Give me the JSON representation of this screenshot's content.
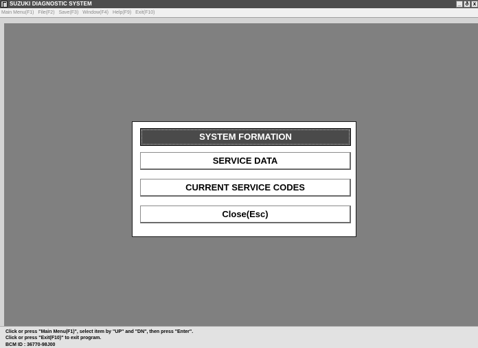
{
  "window": {
    "title": "SUZUKI DIAGNOSTIC SYSTEM",
    "controls": [
      "_",
      "ð",
      "x"
    ]
  },
  "menubar": {
    "items": [
      {
        "label": "Main Menu(F1)"
      },
      {
        "label": "File(F2)"
      },
      {
        "label": "Save(F3)"
      },
      {
        "label": "Window(F4)"
      },
      {
        "label": "Help(F9)"
      },
      {
        "label": "Exit(F10)"
      }
    ]
  },
  "dialog": {
    "options": [
      {
        "label": "SYSTEM FORMATION",
        "selected": true
      },
      {
        "label": "SERVICE DATA",
        "selected": false
      },
      {
        "label": "CURRENT SERVICE CODES",
        "selected": false
      },
      {
        "label": "Close(Esc)",
        "selected": false
      }
    ]
  },
  "status": {
    "line1": "Click or press \"Main Menu(F1)\", select item by \"UP\" and \"DN\", then press \"Enter\".",
    "line2": "Click or press \"Exit(F10)\" to exit program.",
    "line3": "BCM ID : 36770-98J00"
  },
  "colors": {
    "titlebar": "#4d4d4d",
    "workspace": "#808080",
    "selected_option": "#4a4a4a",
    "dialog_bg": "#ffffff"
  },
  "icons": {
    "app": "app-logo-icon",
    "minimize": "minimize-icon",
    "restore": "restore-icon",
    "close": "close-icon"
  }
}
